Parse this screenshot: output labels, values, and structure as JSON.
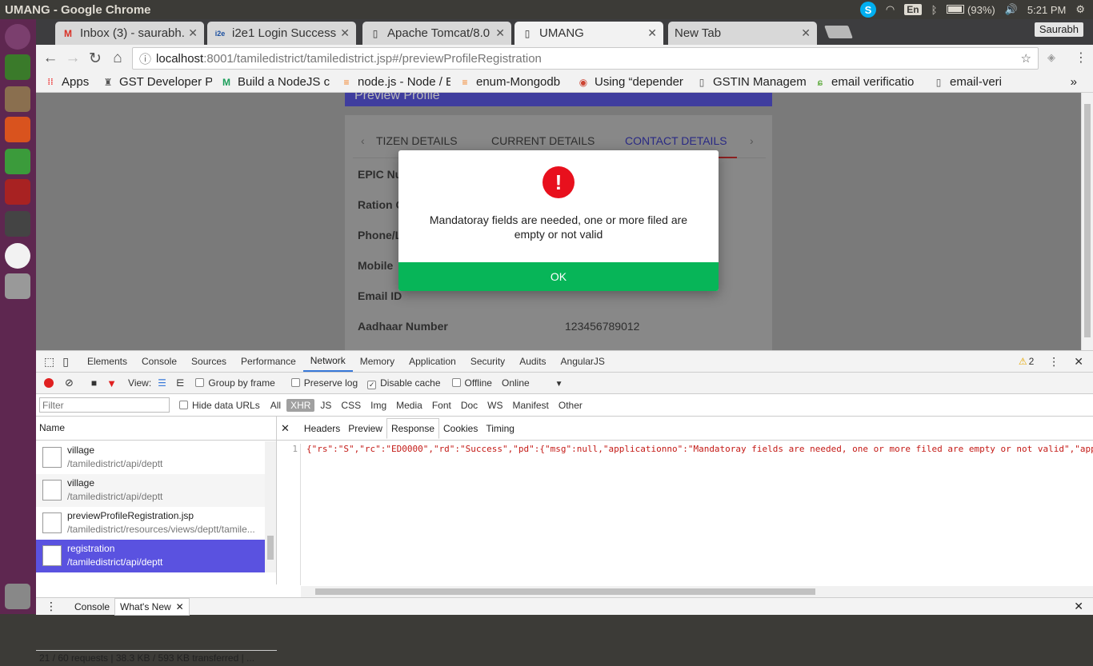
{
  "os": {
    "window_title": "UMANG - Google Chrome",
    "tray": {
      "keyboard": "En",
      "battery": "(93%)",
      "time": "5:21 PM",
      "user": "Saurabh"
    }
  },
  "chrome": {
    "tabs": [
      {
        "title": "Inbox (3) - saurabh.",
        "icon": "gmail-icon"
      },
      {
        "title": "i2e1 Login Success!",
        "icon": "i2e1-icon"
      },
      {
        "title": "Apache Tomcat/8.0",
        "icon": "page-icon"
      },
      {
        "title": "UMANG",
        "icon": "page-icon"
      },
      {
        "title": "New Tab",
        "icon": ""
      }
    ],
    "url_host": "localhost",
    "url_rest": ":8001/tamiledistrict/tamiledistrict.jsp#/previewProfileRegistration",
    "bookmarks": [
      "Apps",
      "GST Developer P",
      "Build a NodeJS c",
      "node.js - Node / E",
      "enum-Mongodb",
      "Using “depender",
      "GSTIN Managem",
      "email verificatio",
      "email-veri"
    ]
  },
  "page": {
    "header": "Preview Profile",
    "tabs": [
      "TIZEN DETAILS",
      "CURRENT DETAILS",
      "CONTACT DETAILS"
    ],
    "fields": [
      {
        "label": "EPIC Nu",
        "value": ""
      },
      {
        "label": "Ration C",
        "value": ""
      },
      {
        "label": "Phone/L",
        "value": ""
      },
      {
        "label": "Mobile",
        "value": ""
      },
      {
        "label": "Email ID",
        "value": ""
      },
      {
        "label": "Aadhaar Number",
        "value": "123456789012"
      }
    ]
  },
  "modal": {
    "message": "Mandatoray fields are needed, one or more filed are empty or not valid",
    "ok_label": "OK"
  },
  "devtools": {
    "tabs": [
      "Elements",
      "Console",
      "Sources",
      "Performance",
      "Network",
      "Memory",
      "Application",
      "Security",
      "Audits",
      "AngularJS"
    ],
    "active_tab": "Network",
    "warnings": "2",
    "toolbar": {
      "view_label": "View:",
      "group_by_frame": "Group by frame",
      "preserve_log": "Preserve log",
      "disable_cache": "Disable cache",
      "offline": "Offline",
      "throttle": "Online"
    },
    "filter_placeholder": "Filter",
    "hide_data_urls": "Hide data URLs",
    "filters": [
      "All",
      "XHR",
      "JS",
      "CSS",
      "Img",
      "Media",
      "Font",
      "Doc",
      "WS",
      "Manifest",
      "Other"
    ],
    "name_header": "Name",
    "requests": [
      {
        "name": "village",
        "path": "/tamiledistrict/api/deptt"
      },
      {
        "name": "village",
        "path": "/tamiledistrict/api/deptt"
      },
      {
        "name": "previewProfileRegistration.jsp",
        "path": "/tamiledistrict/resources/views/deptt/tamile..."
      },
      {
        "name": "registration",
        "path": "/tamiledistrict/api/deptt"
      }
    ],
    "summary": "21 / 60 requests  |  38.3 KB / 593 KB transferred  | ...",
    "detail_tabs": [
      "Headers",
      "Preview",
      "Response",
      "Cookies",
      "Timing"
    ],
    "response_line_no": "1",
    "response_text": "{\"rs\":\"S\",\"rc\":\"ED0000\",\"rd\":\"Success\",\"pd\":{\"msg\":null,\"applicationno\":\"Mandatoray fields are needed, one or more filed are empty or not valid\",\"app",
    "drawer_tabs": [
      "Console",
      "What's New"
    ]
  }
}
